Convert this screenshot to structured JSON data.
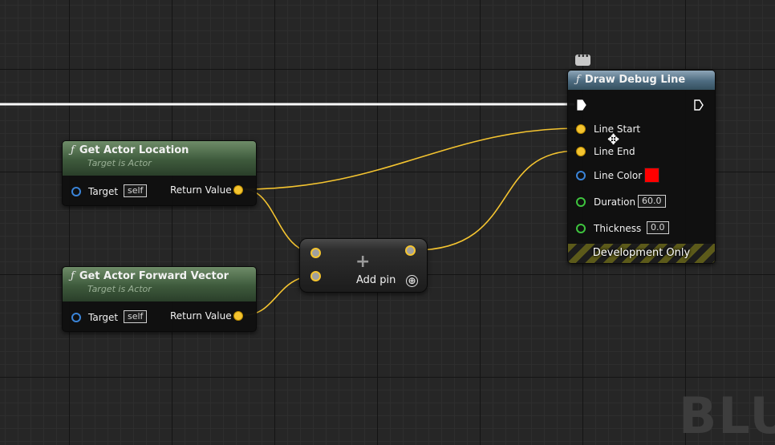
{
  "graph": {
    "watermark": "BLU",
    "colors": {
      "exec_wire": "#ffffff",
      "vector_wire": "#f4c430",
      "pure_header": "#4a6a46",
      "call_header": "#4d6b80"
    }
  },
  "nodes": {
    "get_location": {
      "fn_icon": "ƒ",
      "title": "Get Actor Location",
      "subtitle": "Target is Actor",
      "target_label": "Target",
      "target_value": "self",
      "return_label": "Return Value"
    },
    "get_forward": {
      "fn_icon": "ƒ",
      "title": "Get Actor Forward Vector",
      "subtitle": "Target is Actor",
      "target_label": "Target",
      "target_value": "self",
      "return_label": "Return Value"
    },
    "add": {
      "plus_symbol": "+",
      "add_pin_label": "Add pin",
      "add_pin_icon": "⊕"
    },
    "draw_debug_line": {
      "fn_icon": "ƒ",
      "title": "Draw Debug Line",
      "line_start_label": "Line Start",
      "line_end_label": "Line End",
      "line_color_label": "Line Color",
      "line_color_value": "#ff0000",
      "duration_label": "Duration",
      "duration_value": "60.0",
      "thickness_label": "Thickness",
      "thickness_value": "0.0",
      "footer": "Development Only"
    }
  }
}
